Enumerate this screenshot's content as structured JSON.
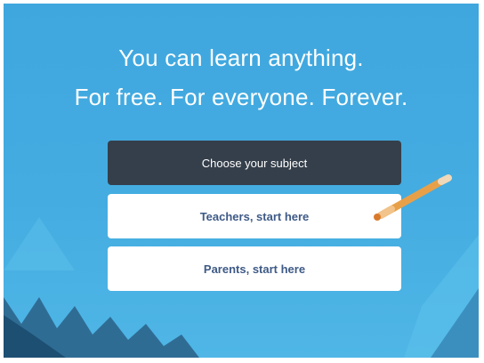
{
  "hero": {
    "line1": "You can learn anything.",
    "line2": "For free. For everyone. Forever."
  },
  "buttons": {
    "choose_subject": "Choose your subject",
    "teachers": "Teachers, start here",
    "parents": "Parents, start here"
  },
  "colors": {
    "background": "#44ace1",
    "dark_button": "#353f4b",
    "light_button": "#ffffff",
    "button_text": "#3e5a86"
  },
  "icons": {
    "pencil": "pencil-icon"
  }
}
